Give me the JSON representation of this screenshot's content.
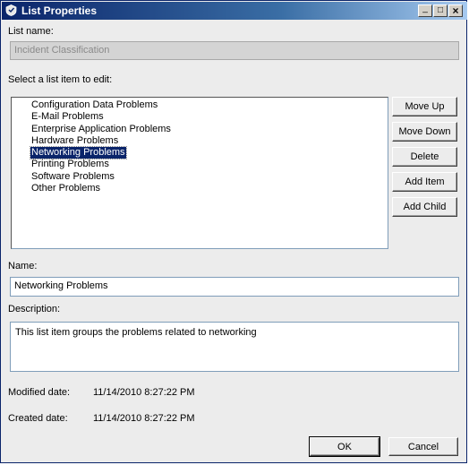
{
  "window": {
    "title": "List Properties",
    "controls": {
      "minimize": "_",
      "maximize": "□",
      "close": "×"
    }
  },
  "list_name": {
    "label": "List name:",
    "value": "Incident Classification"
  },
  "list_items": {
    "label": "Select a list item to edit:",
    "items": [
      "Configuration Data Problems",
      "E-Mail Problems",
      "Enterprise Application Problems",
      "Hardware Problems",
      "Networking Problems",
      "Printing Problems",
      "Software Problems",
      "Other Problems"
    ],
    "selected": "Networking Problems"
  },
  "actions": {
    "move_up": "Move Up",
    "move_down": "Move Down",
    "delete": "Delete",
    "add_item": "Add Item",
    "add_child": "Add Child"
  },
  "name": {
    "label": "Name:",
    "value": "Networking Problems"
  },
  "description": {
    "label": "Description:",
    "value": "This list item groups the problems related to networking"
  },
  "modified": {
    "label": "Modified date:",
    "value": "11/14/2010 8:27:22 PM"
  },
  "created": {
    "label": "Created date:",
    "value": "11/14/2010 8:27:22 PM"
  },
  "footer": {
    "ok": "OK",
    "cancel": "Cancel"
  },
  "colors": {
    "titlebar": "#0a246a",
    "selection": "#0a246a"
  }
}
